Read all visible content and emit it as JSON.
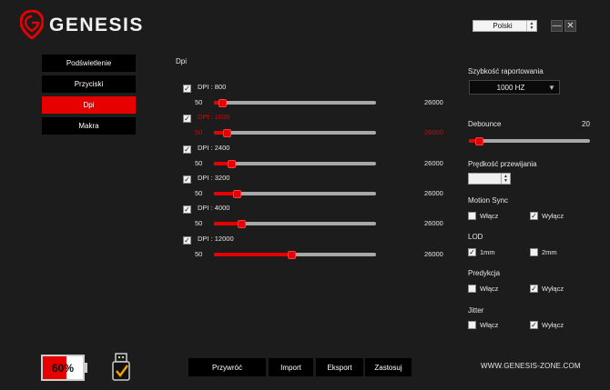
{
  "header": {
    "brand": "GENESIS",
    "language": "Polski",
    "minimize_label": "—",
    "close_label": "✕"
  },
  "nav": {
    "items": [
      {
        "label": "Podświetlenie"
      },
      {
        "label": "Przyciski"
      },
      {
        "label": "Dpi",
        "active": true
      },
      {
        "label": "Makra"
      }
    ]
  },
  "dpi": {
    "title": "Dpi",
    "levels": [
      {
        "label": "DPI : 800",
        "value": 800,
        "min": "50",
        "max": "26000",
        "checked": true,
        "active": false
      },
      {
        "label": "DPI : 1600",
        "value": 1600,
        "min": "50",
        "max": "26000",
        "checked": true,
        "active": true
      },
      {
        "label": "DPI : 2400",
        "value": 2400,
        "min": "50",
        "max": "26000",
        "checked": true,
        "active": false
      },
      {
        "label": "DPI : 3200",
        "value": 3200,
        "min": "50",
        "max": "26000",
        "checked": true,
        "active": false
      },
      {
        "label": "DPI : 4000",
        "value": 4000,
        "min": "50",
        "max": "26000",
        "checked": true,
        "active": false
      },
      {
        "label": "DPI : 12000",
        "value": 12000,
        "min": "50",
        "max": "26000",
        "checked": true,
        "active": false
      }
    ]
  },
  "settings": {
    "report_rate_label": "Szybkość raportowania",
    "report_rate_value": "1000 HZ",
    "debounce_label": "Debounce",
    "debounce_value": "20",
    "debounce_fraction": 0.07,
    "scroll_speed_label": "Prędkość przewijania",
    "motion_sync": {
      "label": "Motion Sync",
      "opt1": "Włącz",
      "opt2": "Wyłącz",
      "selected": "opt2"
    },
    "lod": {
      "label": "LOD",
      "opt1": "1mm",
      "opt2": "2mm",
      "selected": "opt1"
    },
    "prediction": {
      "label": "Predykcja",
      "opt1": "Włącz",
      "opt2": "Wyłącz",
      "selected": "opt2"
    },
    "jitter": {
      "label": "Jitter",
      "opt1": "Włącz",
      "opt2": "Wyłącz",
      "selected": "opt2"
    }
  },
  "footer": {
    "battery": "60%",
    "battery_level": 0.6,
    "buttons": {
      "restore": "Przywróć",
      "import": "Import",
      "export": "Eksport",
      "apply": "Zastosuj"
    },
    "website": "WWW.GENESIS-ZONE.COM"
  },
  "colors": {
    "accent": "#e60000",
    "background": "#1c1c1c"
  }
}
